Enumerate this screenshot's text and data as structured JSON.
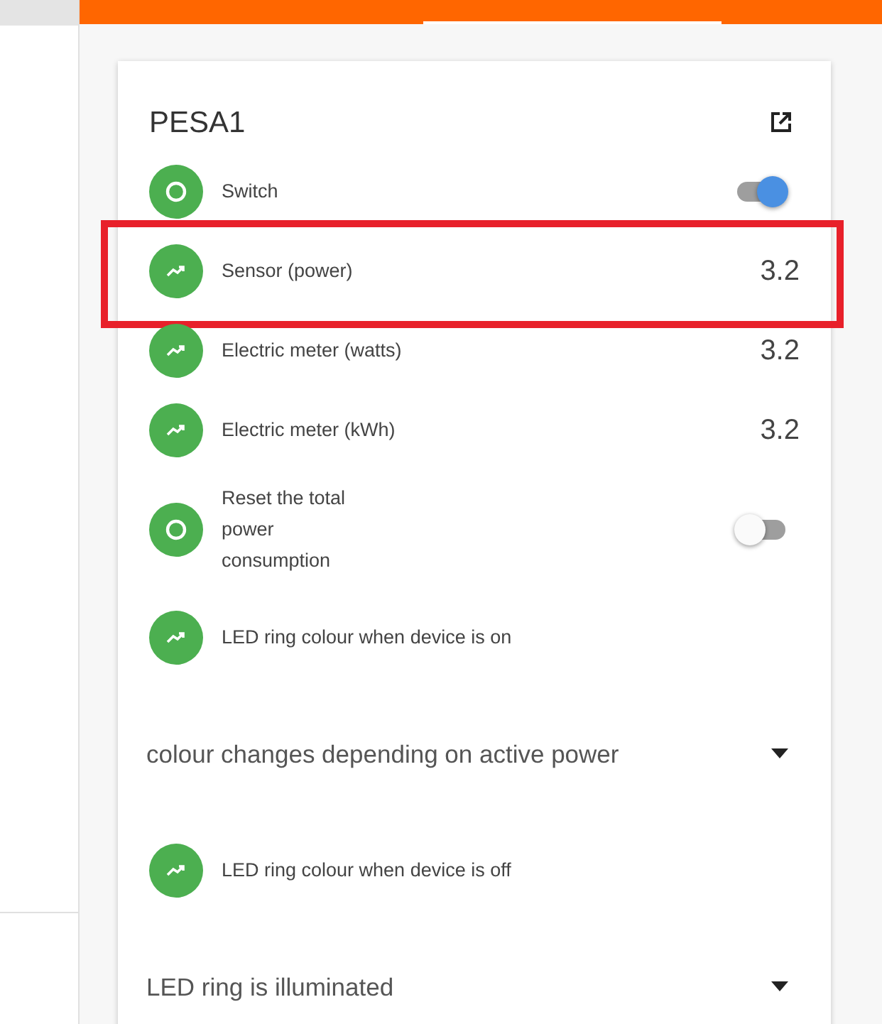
{
  "card": {
    "title": "PESA1",
    "rows": [
      {
        "kind": "toggle",
        "label": "Switch",
        "on": true
      },
      {
        "kind": "sensor",
        "label": "Sensor (power)",
        "value": "3.2",
        "highlighted": true
      },
      {
        "kind": "sensor",
        "label": "Electric meter (watts)",
        "value": "3.2",
        "highlighted": false
      },
      {
        "kind": "sensor",
        "label": "Electric meter (kWh)",
        "value": "3.2",
        "highlighted": false
      },
      {
        "kind": "toggle",
        "label": "Reset the total power consumption",
        "on": false
      },
      {
        "kind": "text",
        "label": "LED ring colour when device is on"
      },
      {
        "kind": "select",
        "value": "colour changes depending on active power"
      },
      {
        "kind": "text",
        "label": "LED ring colour when device is off"
      },
      {
        "kind": "select",
        "value": "LED ring is illuminated"
      }
    ]
  }
}
